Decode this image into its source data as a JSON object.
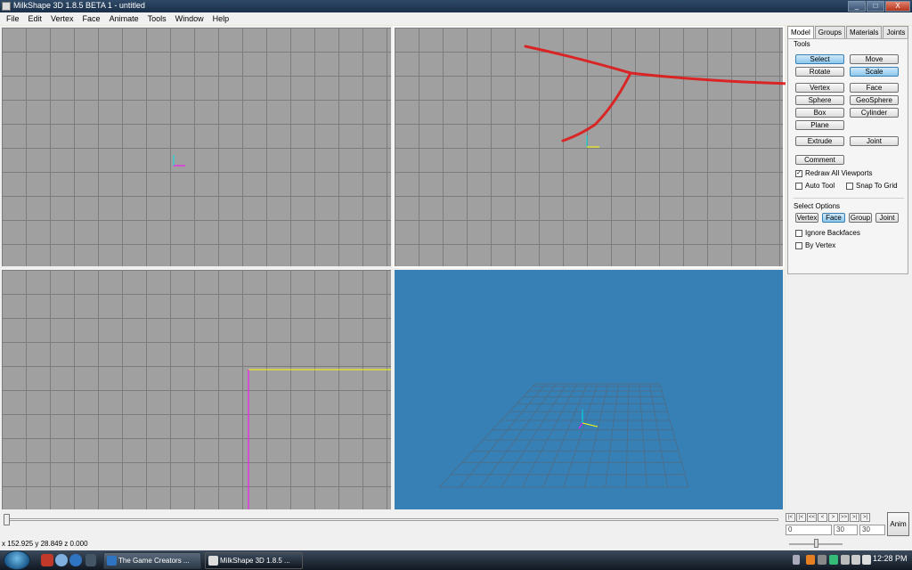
{
  "window": {
    "title": "MilkShape 3D 1.8.5 BETA 1 - untitled",
    "minimize": "_",
    "maximize": "□",
    "close": "X"
  },
  "menu": [
    "File",
    "Edit",
    "Vertex",
    "Face",
    "Animate",
    "Tools",
    "Window",
    "Help"
  ],
  "panel": {
    "tabs": [
      "Model",
      "Groups",
      "Materials",
      "Joints"
    ],
    "tools_label": "Tools",
    "tools": [
      "Select",
      "Move",
      "Rotate",
      "Scale",
      "Vertex",
      "Face",
      "Sphere",
      "GeoSphere",
      "Box",
      "Cylinder",
      "Plane",
      "Extrude",
      "Joint",
      "Comment"
    ],
    "checks": [
      {
        "label": "Redraw All Viewports",
        "checked": true
      },
      {
        "label": "Auto Tool",
        "checked": false
      },
      {
        "label": "Snap To Grid",
        "checked": false
      }
    ],
    "select_options_label": "Select Options",
    "select_options": [
      "Vertex",
      "Face",
      "Group",
      "Joint"
    ],
    "select_checks": [
      {
        "label": "Ignore Backfaces",
        "checked": false
      },
      {
        "label": "By Vertex",
        "checked": false
      }
    ]
  },
  "timeline": {
    "nav": [
      "|<",
      "|<",
      "<<",
      "<",
      ">",
      ">>",
      ">|",
      ">|"
    ],
    "frame_current": "0",
    "frame_end": "30",
    "frame_total": "30",
    "anim_label": "Anim"
  },
  "status": {
    "coords": "x 152.925 y 28.849 z 0.000"
  },
  "taskbar": {
    "tasks": [
      "The Game Creators ...",
      "MilkShape 3D 1.8.5 ..."
    ],
    "clock": "12:28 PM"
  }
}
